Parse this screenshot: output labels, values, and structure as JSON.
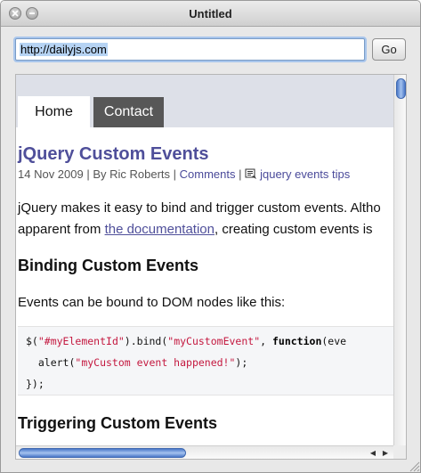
{
  "window": {
    "title": "Untitled"
  },
  "toolbar": {
    "url_value": "http://dailyjs.com",
    "go_label": "Go"
  },
  "page": {
    "nav": {
      "tabs": [
        {
          "label": "Home",
          "active": true
        },
        {
          "label": "Contact",
          "active": false
        }
      ]
    },
    "post": {
      "title": "jQuery Custom Events",
      "meta_date_author": "14 Nov 2009 | By Ric Roberts | ",
      "meta_comments": "Comments",
      "meta_sep": " | ",
      "meta_tags": "jquery events tips",
      "para1_line1": "jQuery makes it easy to bind and trigger custom events. Altho",
      "para1_line2_pre": "apparent from ",
      "para1_link": "the documentation",
      "para1_line2_post": ", creating custom events is",
      "heading1": "Binding Custom Events",
      "para2": "Events can be bound to DOM nodes like this:",
      "code": {
        "l1_a": "$(",
        "l1_str1": "\"#myElementId\"",
        "l1_b": ").bind(",
        "l1_str2": "\"myCustomEvent\"",
        "l1_c": ", ",
        "l1_kw": "function",
        "l1_d": "(eve",
        "l2_a": "  alert(",
        "l2_str": "\"myCustom event happened!\"",
        "l2_b": ");",
        "l3": "});"
      },
      "heading2": "Triggering Custom Events"
    }
  },
  "icons": {
    "close": "close-icon",
    "minimize": "minimize-icon",
    "tag": "tag-icon",
    "resize": "resize-grip-icon"
  },
  "colors": {
    "link": "#4f4f9a",
    "nav_bg": "#dde0e8",
    "tab_inactive": "#575757",
    "code_string": "#c4183f",
    "scroll_thumb": "#4a78c8"
  }
}
